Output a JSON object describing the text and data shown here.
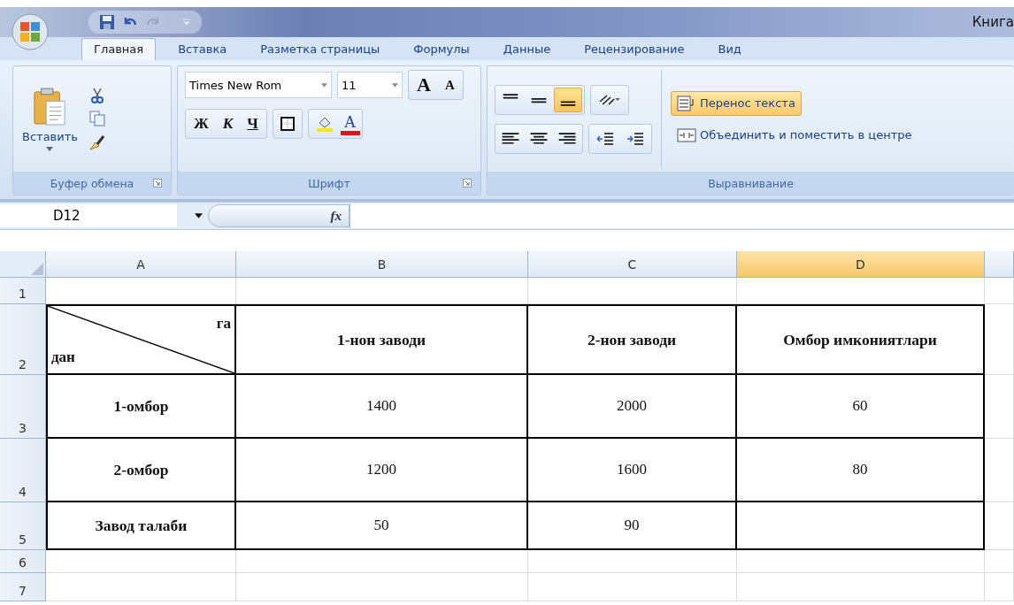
{
  "title_bar": {
    "title": "Книга"
  },
  "tabs": [
    {
      "label": "Главная",
      "selected": true
    },
    {
      "label": "Вставка",
      "selected": false
    },
    {
      "label": "Разметка страницы",
      "selected": false
    },
    {
      "label": "Формулы",
      "selected": false
    },
    {
      "label": "Данные",
      "selected": false
    },
    {
      "label": "Рецензирование",
      "selected": false
    },
    {
      "label": "Вид",
      "selected": false
    }
  ],
  "ribbon": {
    "clipboard": {
      "label": "Буфер обмена",
      "paste": "Вставить"
    },
    "font": {
      "label": "Шрифт",
      "font_name": "Times New Rom",
      "font_size": "11",
      "grow": "A",
      "shrink": "A",
      "bold": "Ж",
      "italic": "К",
      "underline": "Ч",
      "font_color": "A"
    },
    "alignment": {
      "label": "Выравнивание",
      "vertical": [
        {
          "selected": false
        },
        {
          "selected": false
        },
        {
          "selected": true
        }
      ],
      "horizontal": [
        {
          "selected": false
        },
        {
          "selected": false
        },
        {
          "selected": false
        }
      ],
      "wrap_text": {
        "label": "Перенос текста",
        "on": true
      },
      "merge": {
        "label": "Объединить и поместить в центре",
        "on": false
      }
    }
  },
  "formula_bar": {
    "name_box": "D12",
    "fx": "fx"
  },
  "sheet": {
    "columns": [
      {
        "label": "A",
        "selected": false
      },
      {
        "label": "B",
        "selected": false
      },
      {
        "label": "C",
        "selected": false
      },
      {
        "label": "D",
        "selected": true
      }
    ],
    "rows": [
      {
        "number": "1",
        "bordered": false,
        "cells": [
          {
            "kind": "empty"
          },
          {
            "kind": "empty"
          },
          {
            "kind": "empty"
          },
          {
            "kind": "empty"
          }
        ]
      },
      {
        "number": "2",
        "bordered": true,
        "cells": [
          {
            "kind": "diagonal",
            "top": "га",
            "bottom": "дан"
          },
          {
            "kind": "text",
            "text": "1-нон заводи",
            "bold": true
          },
          {
            "kind": "text",
            "text": "2-нон заводи",
            "bold": true
          },
          {
            "kind": "text",
            "text": "Омбор имкониятлари",
            "bold": true
          }
        ]
      },
      {
        "number": "3",
        "bordered": true,
        "cells": [
          {
            "kind": "text",
            "text": "1-омбор",
            "bold": true
          },
          {
            "kind": "text",
            "text": "1400",
            "bold": false
          },
          {
            "kind": "text",
            "text": "2000",
            "bold": false
          },
          {
            "kind": "text",
            "text": "60",
            "bold": false
          }
        ]
      },
      {
        "number": "4",
        "bordered": true,
        "cells": [
          {
            "kind": "text",
            "text": "2-омбор",
            "bold": true
          },
          {
            "kind": "text",
            "text": "1200",
            "bold": false
          },
          {
            "kind": "text",
            "text": "1600",
            "bold": false
          },
          {
            "kind": "text",
            "text": "80",
            "bold": false
          }
        ]
      },
      {
        "number": "5",
        "bordered": true,
        "cells": [
          {
            "kind": "text",
            "text": "Завод талаби",
            "bold": true
          },
          {
            "kind": "text",
            "text": "50",
            "bold": false
          },
          {
            "kind": "text",
            "text": "90",
            "bold": false
          },
          {
            "kind": "empty"
          }
        ]
      },
      {
        "number": "6",
        "bordered": false,
        "cells": [
          {
            "kind": "empty"
          },
          {
            "kind": "empty"
          },
          {
            "kind": "empty"
          },
          {
            "kind": "empty"
          }
        ]
      },
      {
        "number": "7",
        "bordered": false,
        "cells": [
          {
            "kind": "empty"
          },
          {
            "kind": "empty"
          },
          {
            "kind": "empty"
          },
          {
            "kind": "empty"
          }
        ]
      }
    ]
  }
}
